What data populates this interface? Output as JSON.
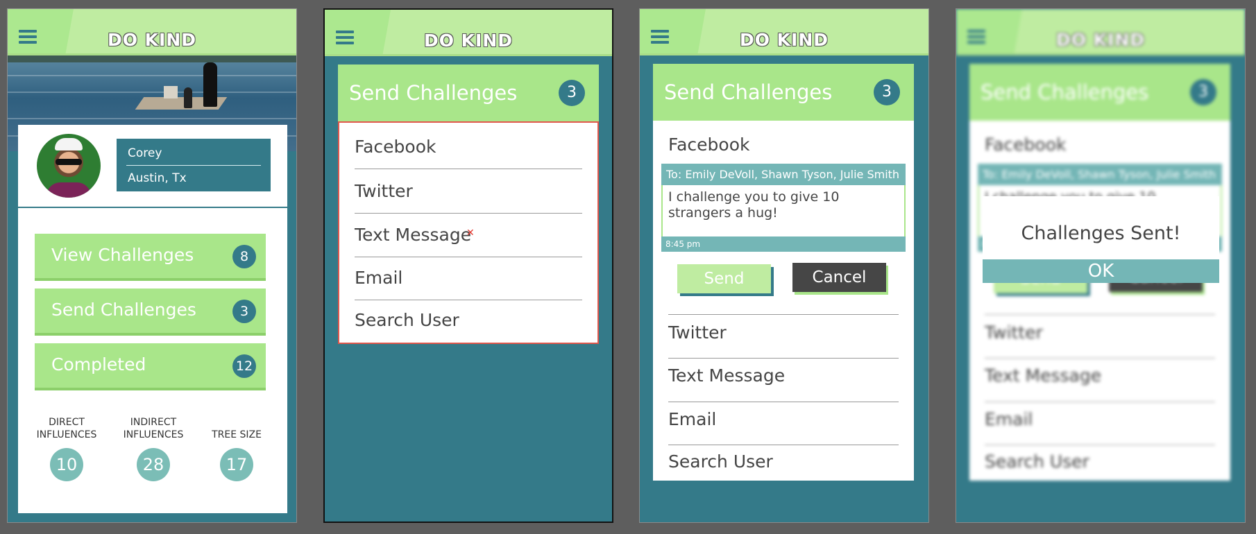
{
  "brand": "DO KIND",
  "profile": {
    "name": "Corey",
    "location": "Austin, Tx",
    "menu": [
      {
        "label": "View Challenges",
        "count": "8"
      },
      {
        "label": "Send Challenges",
        "count": "3"
      },
      {
        "label": "Completed",
        "count": "12"
      }
    ],
    "stats": [
      {
        "label": "DIRECT INFLUENCES",
        "value": "10"
      },
      {
        "label": "INDIRECT INFLUENCES",
        "value": "28"
      },
      {
        "label": "TREE SIZE",
        "value": "17"
      }
    ]
  },
  "send": {
    "title": "Send Challenges",
    "count": "3",
    "options": [
      "Facebook",
      "Twitter",
      "Text Message",
      "Email",
      "Search User"
    ]
  },
  "compose": {
    "to": "To: Emily DeVoll, Shawn Tyson, Julie Smith",
    "message": "I challenge you to give 10 strangers a hug!",
    "time": "8:45 pm",
    "send_label": "Send",
    "cancel_label": "Cancel"
  },
  "dialog": {
    "message": "Challenges Sent!",
    "ok_label": "OK"
  },
  "colors": {
    "teal": "#347a89",
    "green": "#a9e68a",
    "light_green": "#bfeca1",
    "muted_teal": "#74b6b6",
    "dark": "#464646"
  }
}
